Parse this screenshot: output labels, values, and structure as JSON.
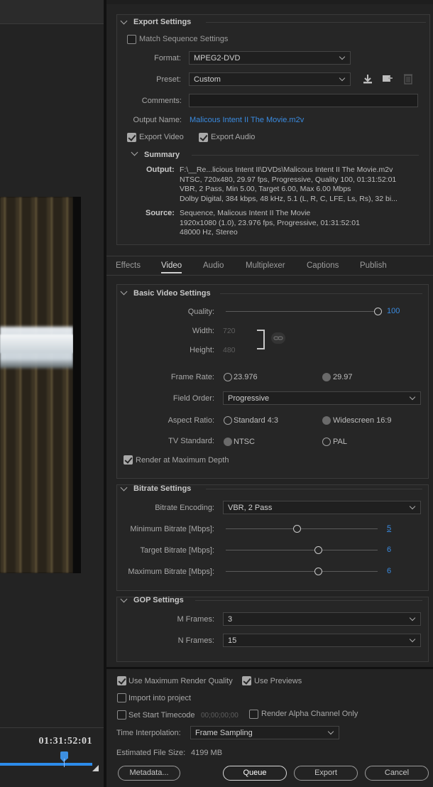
{
  "export_settings": {
    "heading": "Export Settings",
    "match_sequence": "Match Sequence Settings",
    "format_label": "Format:",
    "format_value": "MPEG2-DVD",
    "preset_label": "Preset:",
    "preset_value": "Custom",
    "comments_label": "Comments:",
    "comments_value": "",
    "output_name_label": "Output Name:",
    "output_name_value": "Malicous Intent II The Movie.m2v",
    "export_video": "Export Video",
    "export_audio": "Export Audio",
    "export_video_checked": true,
    "export_audio_checked": true,
    "match_sequence_checked": false
  },
  "summary": {
    "heading": "Summary",
    "output_label": "Output:",
    "output_lines": [
      "F:\\__Re...licious Intent II\\DVDs\\Malicous Intent II The Movie.m2v",
      "NTSC, 720x480, 29.97 fps, Progressive, Quality 100, 01:31:52:01",
      "VBR, 2 Pass, Min 5.00, Target 6.00, Max 6.00 Mbps",
      "Dolby Digital, 384 kbps, 48 kHz, 5.1 (L, R, C, LFE, Ls, Rs), 32 bi..."
    ],
    "source_label": "Source:",
    "source_lines": [
      "Sequence, Malicous  Intent II The Movie",
      "1920x1080 (1.0), 23.976 fps, Progressive, 01:31:52:01",
      "48000 Hz, Stereo"
    ]
  },
  "tabs": [
    "Effects",
    "Video",
    "Audio",
    "Multiplexer",
    "Captions",
    "Publish"
  ],
  "active_tab": "Video",
  "basic_video": {
    "heading": "Basic Video Settings",
    "quality_label": "Quality:",
    "quality_value": "100",
    "width_label": "Width:",
    "width_value": "720",
    "height_label": "Height:",
    "height_value": "480",
    "frame_rate_label": "Frame Rate:",
    "frame_rate_a": "23.976",
    "frame_rate_b": "29.97",
    "frame_rate_selected": "29.97",
    "field_order_label": "Field Order:",
    "field_order_value": "Progressive",
    "aspect_label": "Aspect Ratio:",
    "aspect_a": "Standard 4:3",
    "aspect_b": "Widescreen 16:9",
    "aspect_selected": "Widescreen 16:9",
    "tv_label": "TV Standard:",
    "tv_a": "NTSC",
    "tv_b": "PAL",
    "tv_selected": "NTSC",
    "render_max_depth": "Render at Maximum Depth",
    "render_max_depth_checked": true
  },
  "bitrate": {
    "heading": "Bitrate Settings",
    "encoding_label": "Bitrate Encoding:",
    "encoding_value": "VBR, 2 Pass",
    "min_label": "Minimum Bitrate [Mbps]:",
    "min_value": "5",
    "min_fraction": 0.47,
    "target_label": "Target Bitrate [Mbps]:",
    "target_value": "6",
    "target_fraction": 0.61,
    "max_label": "Maximum Bitrate [Mbps]:",
    "max_value": "6",
    "max_fraction": 0.61
  },
  "gop": {
    "heading": "GOP Settings",
    "m_label": "M Frames:",
    "m_value": "3",
    "n_label": "N Frames:",
    "n_value": "15"
  },
  "footer": {
    "use_max_render": "Use Maximum Render Quality",
    "use_max_render_checked": true,
    "use_previews": "Use Previews",
    "use_previews_checked": true,
    "import_into_project": "Import into project",
    "import_into_project_checked": false,
    "set_start_timecode": "Set Start Timecode",
    "set_start_timecode_checked": false,
    "start_timecode_value": "00;00;00;00",
    "render_alpha": "Render Alpha Channel Only",
    "render_alpha_checked": false,
    "time_interp_label": "Time Interpolation:",
    "time_interp_value": "Frame Sampling",
    "est_size_label": "Estimated File Size:",
    "est_size_value": "4199 MB",
    "metadata_btn": "Metadata...",
    "queue_btn": "Queue",
    "export_btn": "Export",
    "cancel_btn": "Cancel"
  },
  "timeline": {
    "timecode": "01:31:52:01",
    "playhead_fraction": 0.7
  }
}
